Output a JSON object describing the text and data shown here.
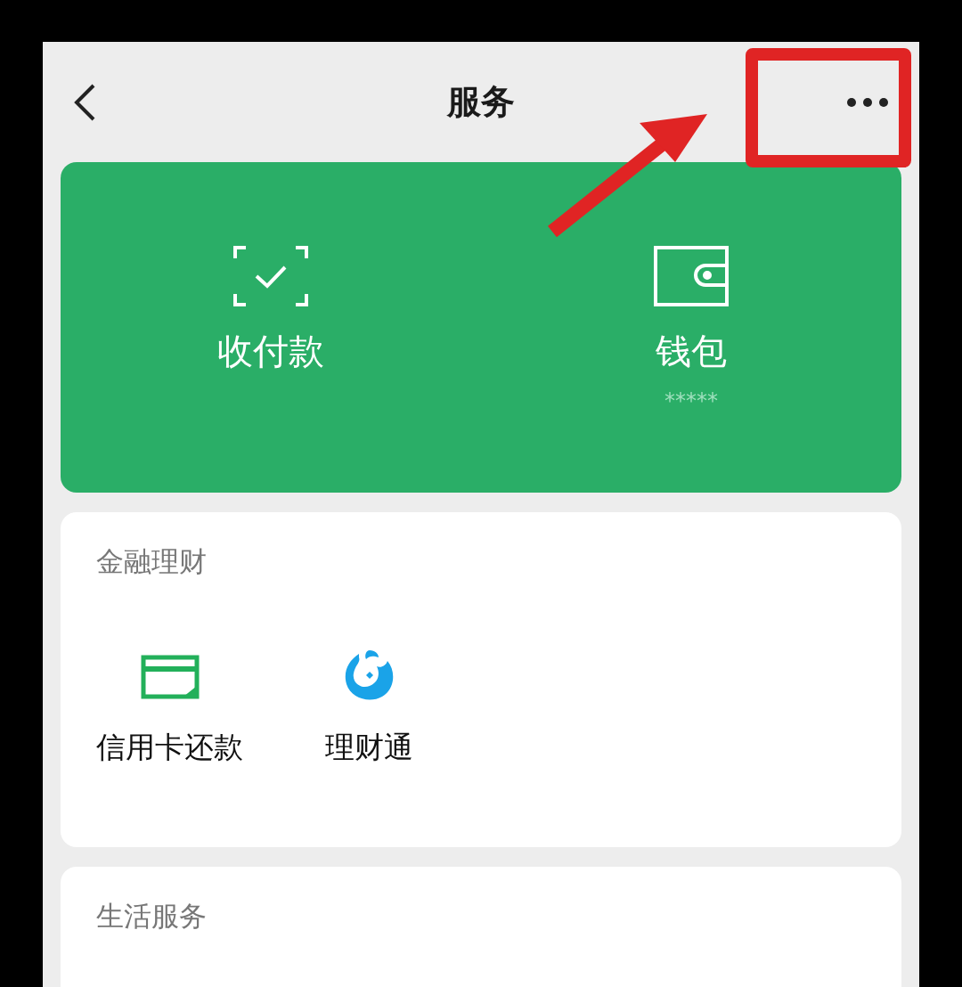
{
  "header": {
    "title": "服务"
  },
  "payment_card": {
    "items": [
      {
        "kind": "scan",
        "label": "收付款"
      },
      {
        "kind": "wallet",
        "label": "钱包",
        "balance": "*****"
      }
    ]
  },
  "sections": [
    {
      "title": "金融理财",
      "items": [
        {
          "kind": "card",
          "label": "信用卡还款"
        },
        {
          "kind": "fund",
          "label": "理财通"
        }
      ]
    },
    {
      "title": "生活服务"
    }
  ]
}
